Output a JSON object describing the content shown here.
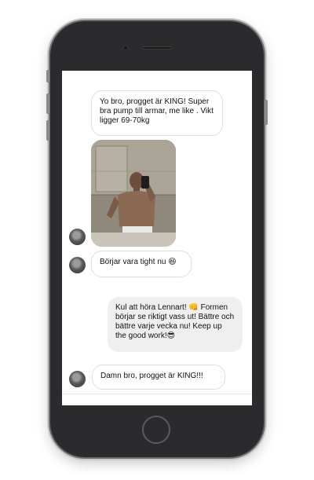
{
  "chat": {
    "messages": [
      {
        "text": "Yo bro, progget är KING! Super bra pump till armar, me like . Vikt ligger 69-70kg"
      },
      {
        "text": "Börjar vara tight nu 😆"
      },
      {
        "text": "Kul att höra Lennart! 👊 Formen börjar se riktigt vass ut! Bättre och bättre varje vecka nu! Keep up the good work!😎"
      },
      {
        "text": "Damn bro, progget är KING!!!"
      }
    ]
  }
}
